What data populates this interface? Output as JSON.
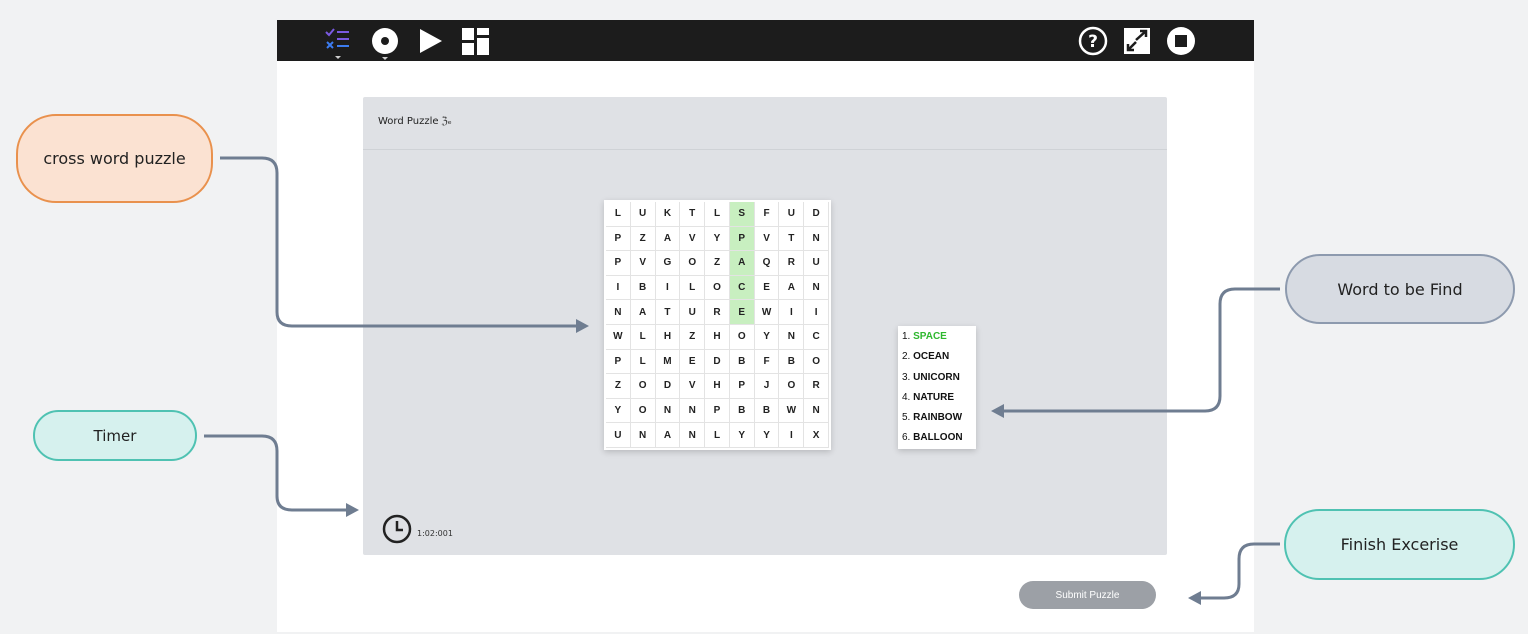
{
  "toolbar": {
    "left_icons": [
      "checklist-icon",
      "record-icon",
      "play-icon",
      "layout-icon"
    ],
    "right_icons": [
      "help-icon",
      "expand-icon",
      "stop-icon"
    ]
  },
  "panel": {
    "title": "Word Puzzle",
    "title_icon": "ℨₑ"
  },
  "grid": {
    "rows": [
      [
        "L",
        "U",
        "K",
        "T",
        "L",
        "S",
        "F",
        "U",
        "D"
      ],
      [
        "P",
        "Z",
        "A",
        "V",
        "Y",
        "P",
        "V",
        "T",
        "N"
      ],
      [
        "P",
        "V",
        "G",
        "O",
        "Z",
        "A",
        "Q",
        "R",
        "U"
      ],
      [
        "I",
        "B",
        "I",
        "L",
        "O",
        "C",
        "E",
        "A",
        "N"
      ],
      [
        "N",
        "A",
        "T",
        "U",
        "R",
        "E",
        "W",
        "I",
        "I"
      ],
      [
        "W",
        "L",
        "H",
        "Z",
        "H",
        "O",
        "Y",
        "N",
        "C"
      ],
      [
        "P",
        "L",
        "M",
        "E",
        "D",
        "B",
        "F",
        "B",
        "O"
      ],
      [
        "Z",
        "O",
        "D",
        "V",
        "H",
        "P",
        "J",
        "O",
        "R"
      ],
      [
        "Y",
        "O",
        "N",
        "N",
        "P",
        "B",
        "B",
        "W",
        "N"
      ],
      [
        "U",
        "N",
        "A",
        "N",
        "L",
        "Y",
        "Y",
        "I",
        "X"
      ]
    ],
    "highlight_color": "#c8efc0"
  },
  "words": [
    {
      "num": "1.",
      "word": "SPACE",
      "found": true
    },
    {
      "num": "2.",
      "word": "OCEAN",
      "found": false
    },
    {
      "num": "3.",
      "word": "UNICORN",
      "found": false
    },
    {
      "num": "4.",
      "word": "NATURE",
      "found": false
    },
    {
      "num": "5.",
      "word": "RAINBOW",
      "found": false
    },
    {
      "num": "6.",
      "word": "BALLOON",
      "found": false
    }
  ],
  "timer": {
    "icon": "clock-icon",
    "value": "1:02:001"
  },
  "submit_label": "Submit Puzzle",
  "annotations": {
    "crossword": "cross word puzzle",
    "timer": "Timer",
    "word_to_find": "Word to be Find",
    "finish": "Finish Excerise"
  },
  "colors": {
    "toolbar_bg": "#1c1c1c",
    "found_word": "#2fb82f",
    "submit_bg": "#9ca0a6",
    "arrow": "#6f7d91"
  }
}
